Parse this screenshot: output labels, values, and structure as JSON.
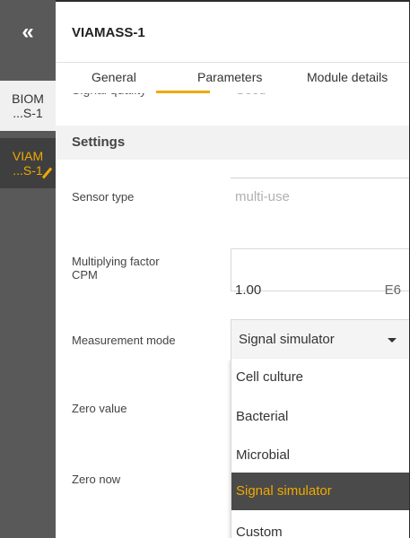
{
  "rail": {
    "collapse_icon": "«",
    "items": [
      {
        "label": "BIOM\n...S-1"
      },
      {
        "label": "VIAM\n...S-1"
      }
    ]
  },
  "header": {
    "title": "VIAMASS-1"
  },
  "tabs": [
    {
      "label": "General"
    },
    {
      "label": "Parameters",
      "active": true
    },
    {
      "label": "Module details"
    }
  ],
  "cut_off_row": {
    "label": "Signal quality",
    "value": "Good"
  },
  "settings": {
    "heading": "Settings",
    "sensor_type": {
      "label": "Sensor type",
      "value": "multi-use"
    },
    "multiplying_factor": {
      "label": "Multiplying factor\nCPM",
      "value": "1.00",
      "unit": "E6"
    },
    "measurement_mode": {
      "label": "Measurement mode",
      "selected": "Signal simulator",
      "options": [
        "Cell culture",
        "Bacterial",
        "Microbial",
        "Signal simulator",
        "Custom"
      ]
    },
    "zero_value": {
      "label": "Zero value"
    },
    "zero_now": {
      "label": "Zero now"
    }
  },
  "colors": {
    "accent": "#f0a800",
    "rail": "#595959",
    "rail_active": "#3f3f3f"
  }
}
